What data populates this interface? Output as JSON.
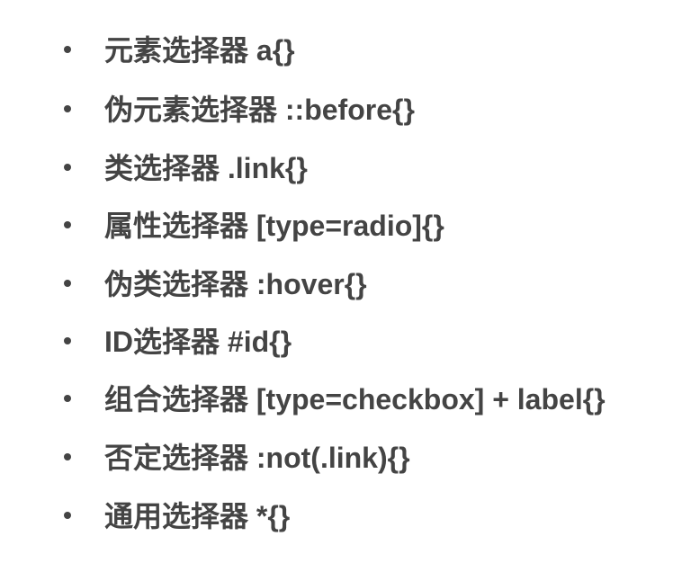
{
  "items": [
    {
      "text": "元素选择器 a{}"
    },
    {
      "text": "伪元素选择器 ::before{}"
    },
    {
      "text": "类选择器 .link{}"
    },
    {
      "text": "属性选择器 [type=radio]{}"
    },
    {
      "text": "伪类选择器 :hover{}"
    },
    {
      "text": "ID选择器 #id{}"
    },
    {
      "text": "组合选择器 [type=checkbox] + label{}"
    },
    {
      "text": "否定选择器 :not(.link){}"
    },
    {
      "text": "通用选择器 *{}"
    }
  ]
}
